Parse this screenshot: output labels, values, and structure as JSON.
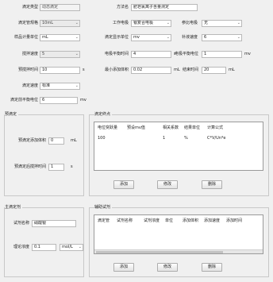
{
  "form": {
    "titration_type": {
      "label": "滴定类型",
      "value": "动态滴定"
    },
    "method_name": {
      "label": "方法名",
      "value": "肥皂氯离子含量测定"
    },
    "burette_spec": {
      "label": "滴定管规格",
      "value": "10mL"
    },
    "working_electrode": {
      "label": "工作电极",
      "value": "银复合电极"
    },
    "reference_electrode": {
      "label": "参比电极",
      "value": "无"
    },
    "sample_unit": {
      "label": "样品计量单位",
      "value": "mL"
    },
    "titration_display_unit": {
      "label": "滴定显示单位",
      "value": "mv"
    },
    "fill_speed": {
      "label": "补液速度",
      "value": "6"
    },
    "stir_speed": {
      "label": "搅拌速度",
      "value": "5"
    },
    "electrode_balance_time": {
      "label": "电极平衡时间",
      "value": "4",
      "unit": "s"
    },
    "electrode_balance_potential": {
      "label": "电极平衡电位",
      "value": "1",
      "unit": "mv"
    },
    "pre_stir_time": {
      "label": "预搅拌时间",
      "value": "10",
      "unit": "s"
    },
    "min_add_volume": {
      "label": "最小添加体积",
      "value": "0.02",
      "unit": "mL"
    },
    "end_time": {
      "label": "结束时间",
      "value": "20",
      "unit": "mL"
    },
    "titration_rate": {
      "label": "滴定速度",
      "value": "标准"
    },
    "pre_titration_potential": {
      "label": "滴定前平衡电位",
      "value": "6",
      "unit": "mv"
    }
  },
  "pre_titration": {
    "title": "预滴定",
    "add_volume": {
      "label": "预滴定添加体积",
      "value": "0",
      "unit": "mL"
    },
    "stir_time": {
      "label": "预滴定后搅拌时间",
      "value": "1",
      "unit": "s"
    }
  },
  "endpoint": {
    "title": "滴定终点",
    "columns": [
      "电位突跃量",
      "预设mv值",
      "相关系数",
      "结果单位",
      "计算公式"
    ],
    "rows": [
      [
        "100",
        "",
        "1",
        "%",
        "C*V/Un*e"
      ]
    ],
    "buttons": {
      "add": "添加",
      "edit": "修改",
      "delete": "删除"
    }
  },
  "main_reagent": {
    "title": "主滴定剂",
    "reagent_name": {
      "label": "试剂名称",
      "value": "硝酸银"
    },
    "theory_concentration": {
      "label": "理论浓度",
      "value": "0.1",
      "unit": "mol/L"
    }
  },
  "aux_reagent": {
    "title": "辅助试剂",
    "columns": [
      "滴定管",
      "试剂名称",
      "试剂浓度",
      "单位",
      "添加体积",
      "添加速度",
      "添加时间"
    ],
    "buttons": {
      "add": "添加",
      "edit": "修改",
      "delete": "删除"
    }
  }
}
